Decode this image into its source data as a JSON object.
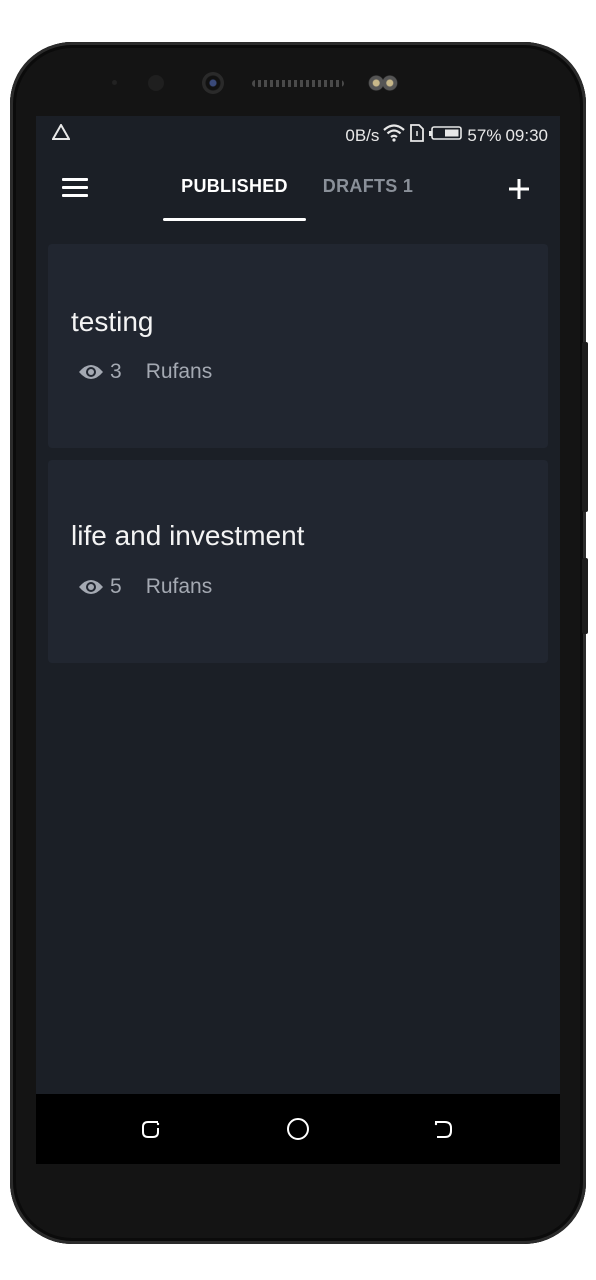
{
  "status_bar": {
    "speed": "0B/s",
    "battery": "57%",
    "time": "09:30"
  },
  "app_bar": {
    "tabs": [
      {
        "label": "PUBLISHED",
        "active": true
      },
      {
        "label": "DRAFTS 1",
        "active": false
      }
    ]
  },
  "posts": [
    {
      "title": "testing",
      "views": "3",
      "author": "Rufans"
    },
    {
      "title": "life and investment",
      "views": "5",
      "author": "Rufans"
    }
  ],
  "icons": {
    "status_left": "app-notification-icon",
    "wifi": "wifi-icon",
    "sim": "sim-card-icon",
    "battery": "battery-icon",
    "menu": "hamburger-menu-icon",
    "add": "plus-icon",
    "views": "eye-icon",
    "nav_recent": "recent-apps-icon",
    "nav_home": "home-icon",
    "nav_back": "back-icon"
  },
  "colors": {
    "background": "#1b1f26",
    "card": "#212630",
    "active_tab": "#ffffff",
    "inactive_tab": "#8a9099",
    "meta_text": "#a4a9b2"
  }
}
